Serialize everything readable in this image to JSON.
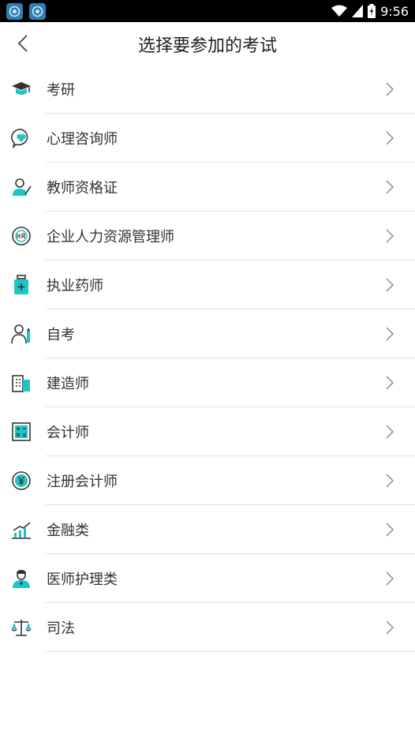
{
  "status_bar": {
    "time": "9:56"
  },
  "header": {
    "title": "选择要参加的考试"
  },
  "colors": {
    "accent": "#1fc4c4",
    "icon_dark": "#333333",
    "divider": "#e3e3e3"
  },
  "exams": [
    {
      "label": "考研",
      "icon": "graduation-cap-icon"
    },
    {
      "label": "心理咨询师",
      "icon": "heart-bubble-icon"
    },
    {
      "label": "教师资格证",
      "icon": "teacher-icon"
    },
    {
      "label": "企业人力资源管理师",
      "icon": "hr-badge-icon"
    },
    {
      "label": "执业药师",
      "icon": "medicine-bottle-icon"
    },
    {
      "label": "自考",
      "icon": "student-icon"
    },
    {
      "label": "建造师",
      "icon": "building-icon"
    },
    {
      "label": "会计师",
      "icon": "calculator-icon"
    },
    {
      "label": "注册会计师",
      "icon": "yuan-coin-icon"
    },
    {
      "label": "金融类",
      "icon": "growth-chart-icon"
    },
    {
      "label": "医师护理类",
      "icon": "doctor-icon"
    },
    {
      "label": "司法",
      "icon": "scales-icon"
    }
  ]
}
